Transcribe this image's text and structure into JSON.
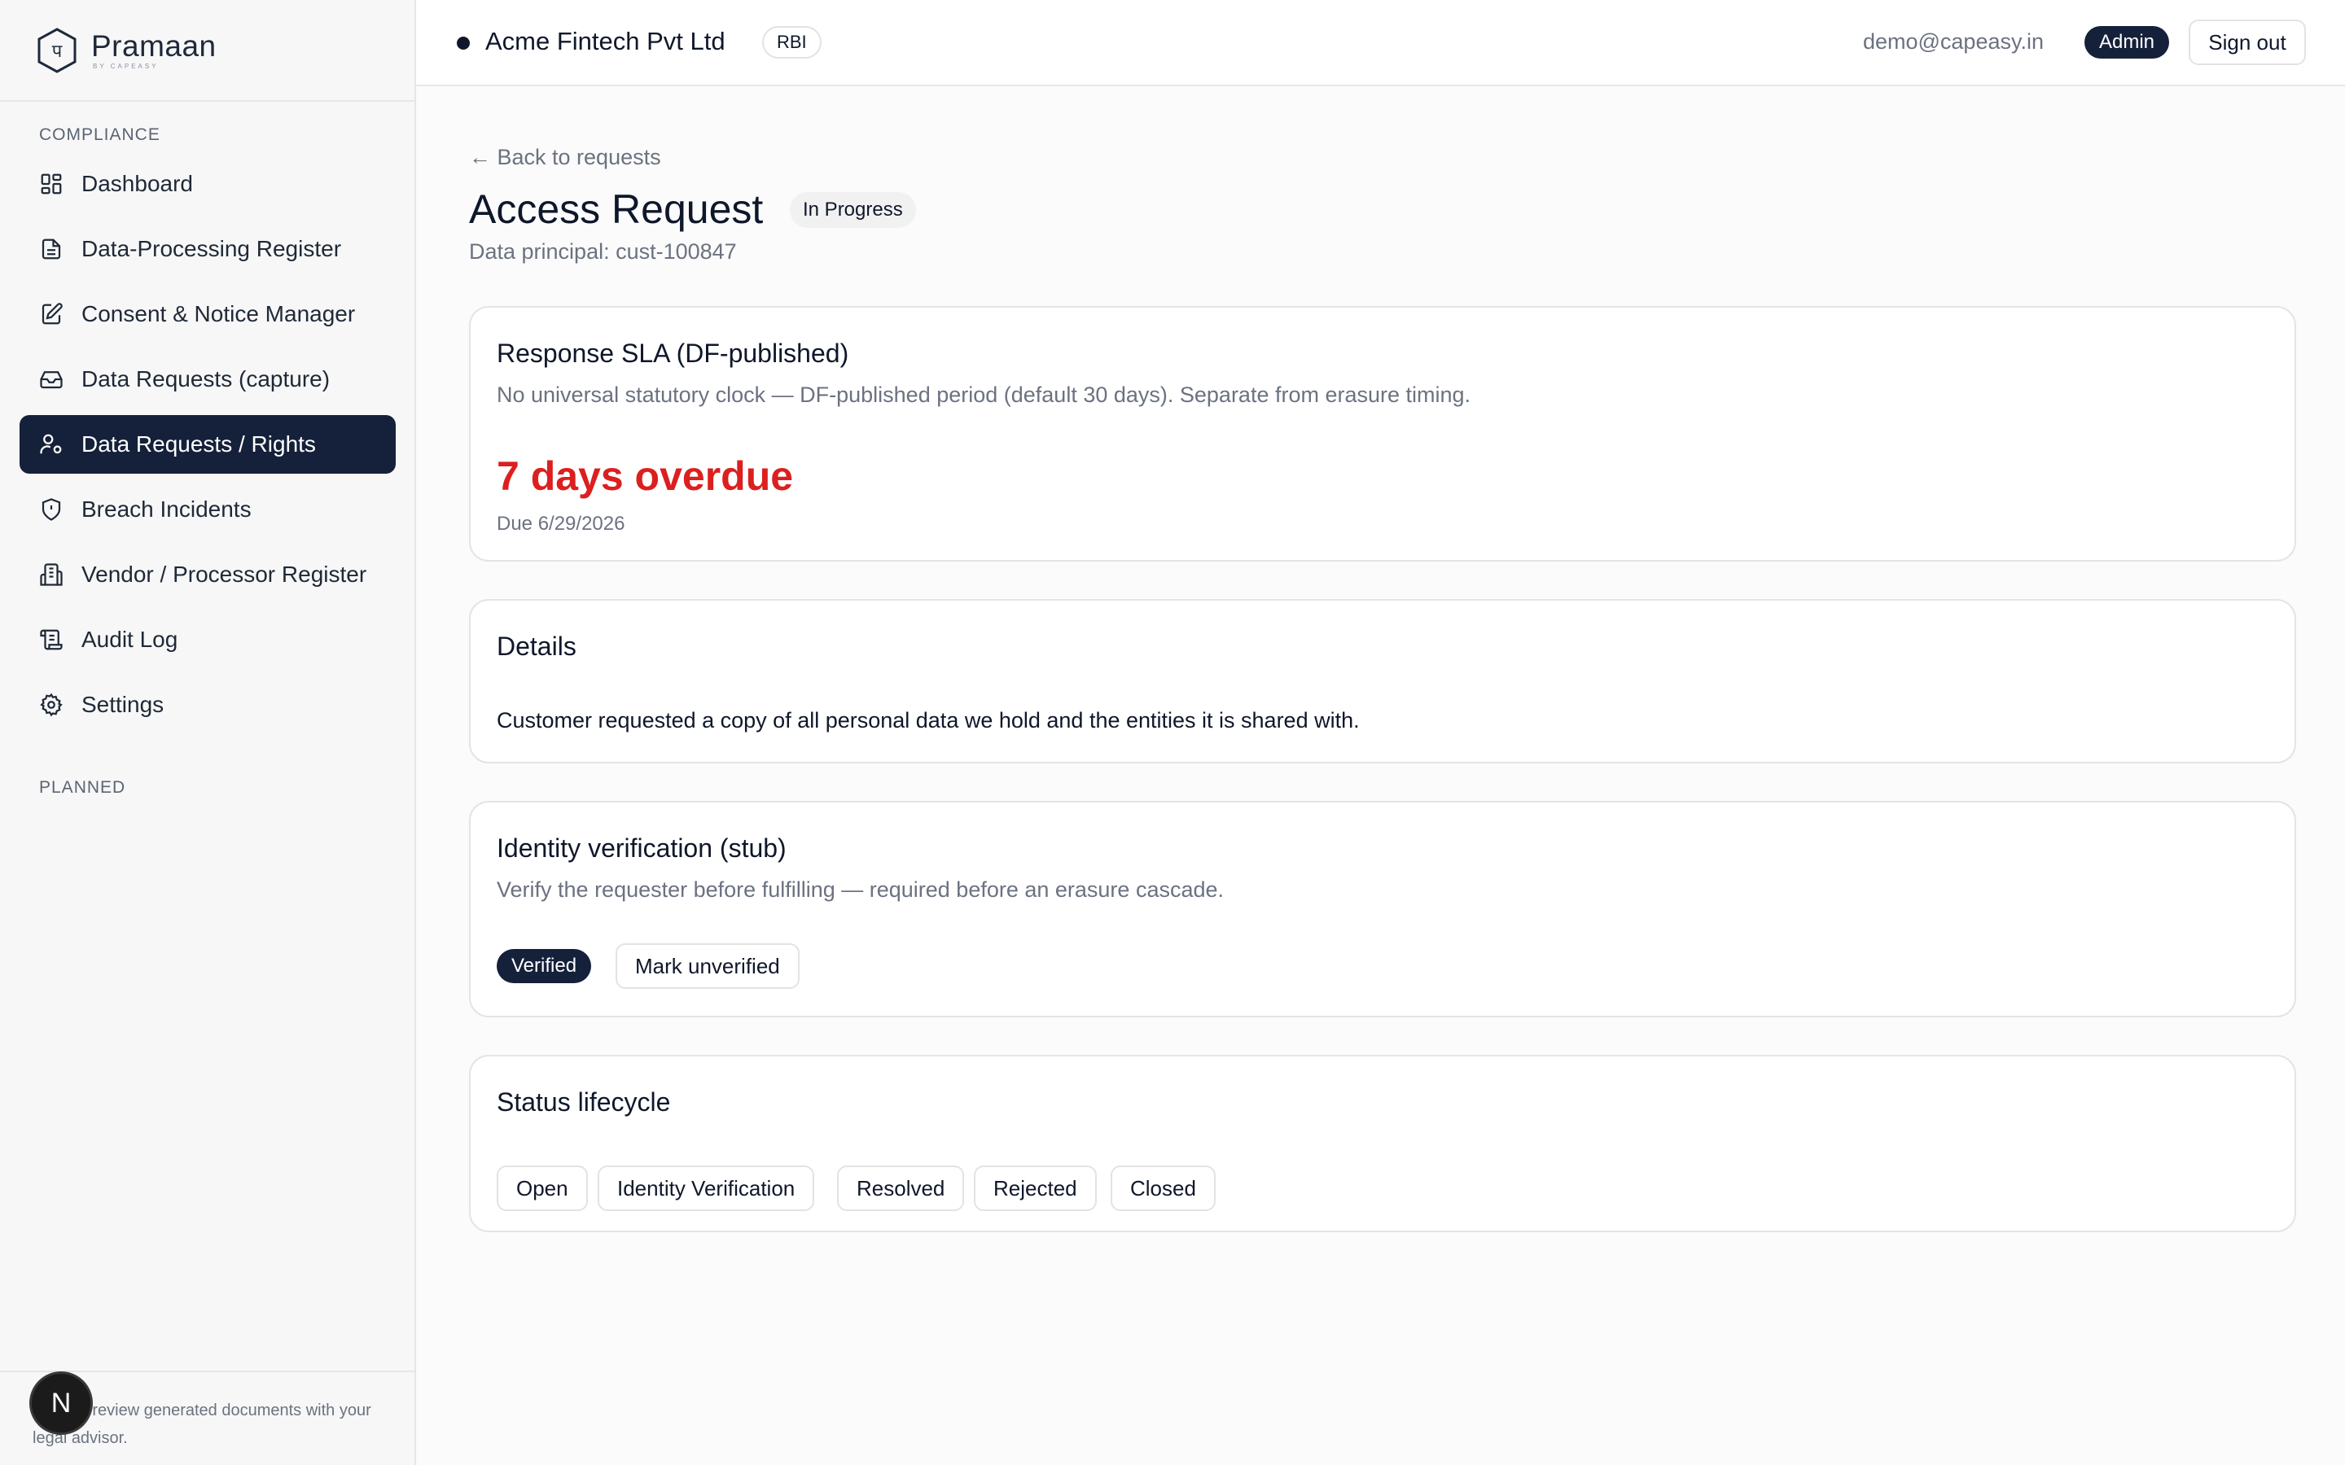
{
  "brand": {
    "name": "Pramaan",
    "sub": "BY CAPEASY",
    "logo_glyph": "प"
  },
  "sidebar": {
    "section_compliance": "COMPLIANCE",
    "section_planned": "PLANNED",
    "items": [
      {
        "label": "Dashboard",
        "icon": "dashboard-icon"
      },
      {
        "label": "Data-Processing Register",
        "icon": "document-icon"
      },
      {
        "label": "Consent & Notice Manager",
        "icon": "edit-document-icon"
      },
      {
        "label": "Data Requests (capture)",
        "icon": "inbox-icon"
      },
      {
        "label": "Data Requests / Rights",
        "icon": "user-gear-icon",
        "active": true
      },
      {
        "label": "Breach Incidents",
        "icon": "shield-alert-icon"
      },
      {
        "label": "Vendor / Processor Register",
        "icon": "building-icon"
      },
      {
        "label": "Audit Log",
        "icon": "scroll-icon"
      },
      {
        "label": "Settings",
        "icon": "gear-icon"
      }
    ],
    "footer_text": "oling — review generated documents with your legal advisor.",
    "n_badge": "N"
  },
  "header": {
    "org_name": "Acme Fintech Pvt Ltd",
    "regulator": "RBI",
    "user_email": "demo@capeasy.in",
    "role": "Admin",
    "signout_label": "Sign out"
  },
  "page": {
    "back_label": "← Back to requests",
    "title": "Access Request",
    "status": "In Progress",
    "principal": "Data principal: cust-100847"
  },
  "sla_card": {
    "title": "Response SLA (DF-published)",
    "description": "No universal statutory clock — DF-published period (default 30 days). Separate from erasure timing.",
    "overdue": "7 days overdue",
    "due": "Due 6/29/2026"
  },
  "details_card": {
    "title": "Details",
    "text": "Customer requested a copy of all personal data we hold and the entities it is shared with."
  },
  "identity_card": {
    "title": "Identity verification (stub)",
    "description": "Verify the requester before fulfilling — required before an erasure cascade.",
    "verified_label": "Verified",
    "mark_unverified_label": "Mark unverified"
  },
  "lifecycle_card": {
    "title": "Status lifecycle",
    "statuses": [
      "Open",
      "Identity Verification",
      "Resolved",
      "Rejected",
      "Closed"
    ]
  },
  "colors": {
    "accent": "#15213a",
    "overdue": "#dc1f1f"
  }
}
